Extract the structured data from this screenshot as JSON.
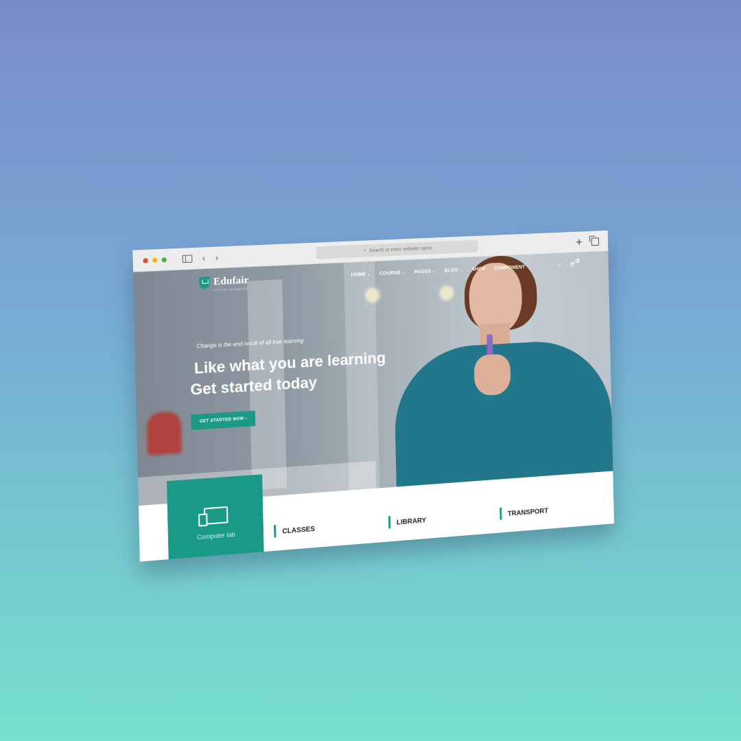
{
  "browser": {
    "address_placeholder": "Search or enter website name",
    "icons": [
      "sidebar-icon",
      "back-icon",
      "forward-icon",
      "search-icon",
      "new-tab-icon",
      "tabs-icon"
    ]
  },
  "site": {
    "logo_text": "Edufair",
    "logo_sub": "ONLINE ACADEMY",
    "nav": [
      {
        "label": "HOME"
      },
      {
        "label": "COURSE"
      },
      {
        "label": "PAGES"
      },
      {
        "label": "BLOG"
      },
      {
        "label": "SHOP"
      },
      {
        "label": "COMPONENT"
      }
    ],
    "cart_count": "0"
  },
  "hero": {
    "tagline": "Change is the end result of all true learning.",
    "headline_line1": "Like what you are learning",
    "headline_line2": "Get started today",
    "cta_label": "GET STARTED NOW",
    "cta_arrow": "›"
  },
  "features": {
    "card_label": "Computer lab",
    "items": [
      {
        "label": "CLASSES"
      },
      {
        "label": "LIBRARY"
      },
      {
        "label": "TRANSPORT"
      }
    ]
  },
  "colors": {
    "accent": "#1a9a86",
    "bg_top": "#7a8cc8",
    "bg_bottom": "#78e0cc"
  }
}
